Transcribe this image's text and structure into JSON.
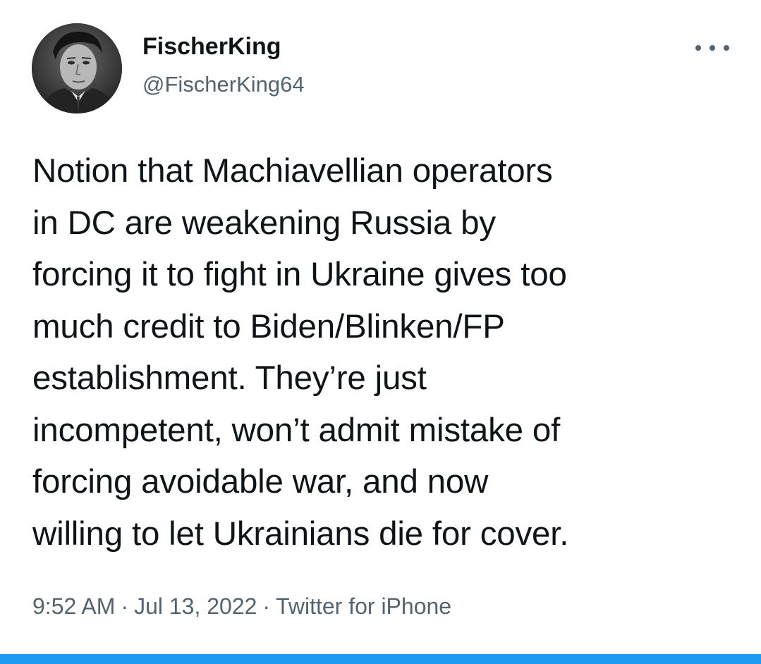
{
  "tweet": {
    "display_name": "FischerKing",
    "handle": "@FischerKing64",
    "text": "Notion that Machiavellian operators\nin DC are weakening Russia by\nforcing it to fight in Ukraine gives too\nmuch credit to Biden/Blinken/FP\nestablishment. They’re just\nincompetent, won’t admit mistake of\nforcing avoidable war, and now\nwilling to let Ukrainians die for cover.",
    "time": "9:52 AM",
    "date": "Jul 13, 2022",
    "source": "Twitter for iPhone",
    "separator": "·"
  },
  "icons": {
    "more": "more-horizontal-icon"
  },
  "colors": {
    "text_primary": "#0f1419",
    "text_secondary": "#536471",
    "accent_bar": "#1d9bf0"
  }
}
